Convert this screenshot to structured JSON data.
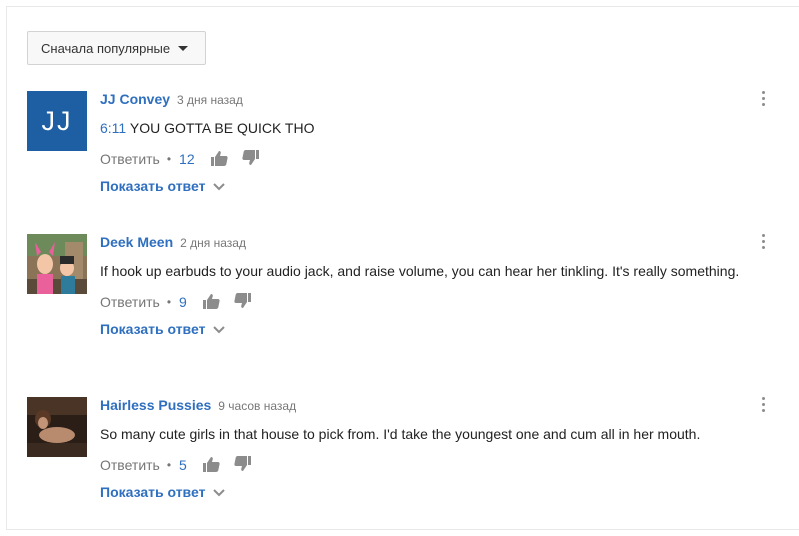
{
  "sort": {
    "label": "Сначала популярные"
  },
  "comments": [
    {
      "author": "JJ Convey",
      "time": "3 дня назад",
      "avatar_text": "JJ",
      "timestamp": "6:11",
      "text": "YOU GOTTA BE QUICK THO",
      "reply_label": "Ответить",
      "likes": "12",
      "show_replies": "Показать ответ"
    },
    {
      "author": "Deek Meen",
      "time": "2 дня назад",
      "text": "If hook up earbuds to your audio jack, and raise volume, you can hear her tinkling. It's really something.",
      "reply_label": "Ответить",
      "likes": "9",
      "show_replies": "Показать ответ"
    },
    {
      "author": "Hairless Pussies",
      "time": "9 часов назад",
      "text": "So many cute girls in that house to pick from. I'd take the youngest one and cum all in her mouth.",
      "reply_label": "Ответить",
      "likes": "5",
      "show_replies": "Показать ответ"
    }
  ],
  "colors": {
    "link": "#2f6fbf",
    "muted": "#767676",
    "avatar_bg": "#1e5fa3"
  }
}
